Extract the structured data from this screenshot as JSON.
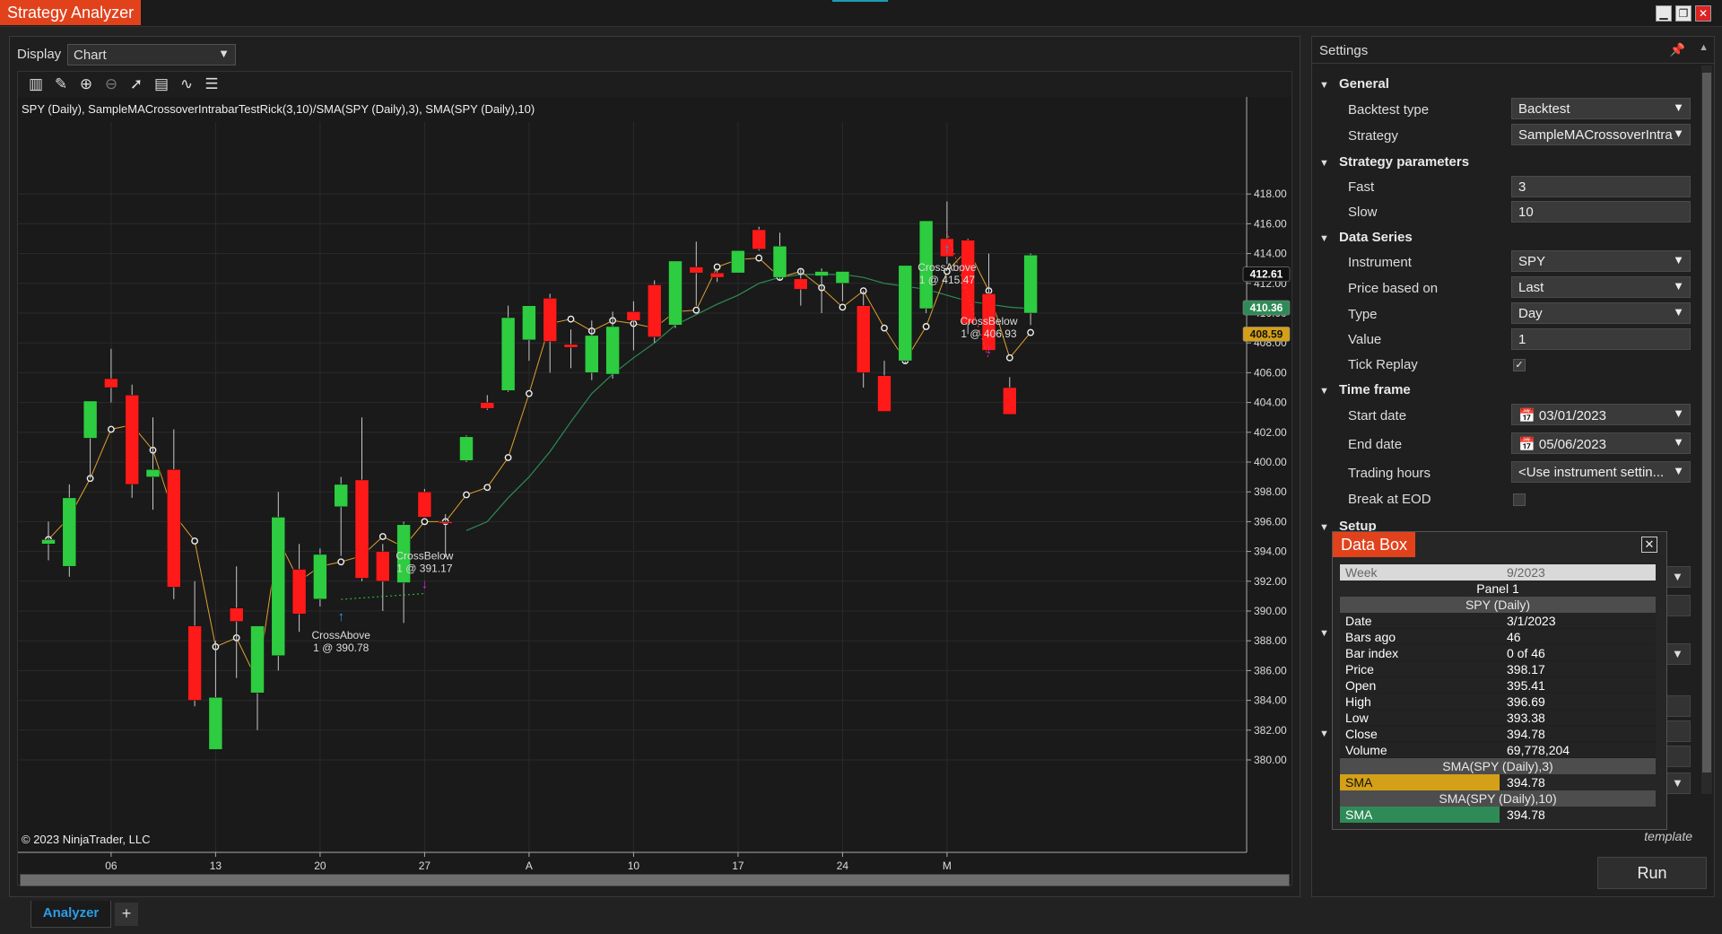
{
  "app": {
    "title": "Strategy Analyzer",
    "window_buttons": [
      "minimize",
      "restore",
      "close"
    ]
  },
  "display": {
    "label": "Display",
    "value": "Chart"
  },
  "toolbar": {
    "icons": [
      "bar-chart-icon",
      "pencil-icon",
      "zoom-in-icon",
      "zoom-out-icon",
      "pointer-icon",
      "properties-icon",
      "indicator-icon",
      "list-icon"
    ]
  },
  "chart": {
    "header": "SPY (Daily), SampleMACrossoverIntrabarTestRick(3,10)/SMA(SPY (Daily),3), SMA(SPY (Daily),10)",
    "copyright": "© 2023 NinjaTrader, LLC",
    "colors": {
      "up": "#2ecc40",
      "down": "#ff1a1a",
      "sma_fast": "#e0a030",
      "sma_slow": "#2e8b57",
      "bg": "#1a1a1a"
    }
  },
  "chart_data": {
    "type": "candlestick",
    "title": "SPY (Daily), SampleMACrossoverIntrabarTestRick(3,10)/SMA(SPY (Daily),3), SMA(SPY (Daily),10)",
    "y_ticks": [
      "380.00",
      "382.00",
      "384.00",
      "386.00",
      "388.00",
      "390.00",
      "392.00",
      "394.00",
      "396.00",
      "398.00",
      "400.00",
      "402.00",
      "404.00",
      "406.00",
      "408.00",
      "410.00",
      "412.00",
      "414.00",
      "416.00",
      "418.00"
    ],
    "ylim": [
      379,
      419.8
    ],
    "x_ticks": [
      "06",
      "13",
      "20",
      "27",
      "A",
      "10",
      "17",
      "24",
      "M"
    ],
    "x_tick_index": [
      3,
      8,
      13,
      18,
      23,
      28,
      33,
      38,
      43
    ],
    "ohlc": [
      [
        394.5,
        396.0,
        393.4,
        394.8
      ],
      [
        393.0,
        398.5,
        392.3,
        397.6
      ],
      [
        401.6,
        404.0,
        398.9,
        404.1
      ],
      [
        405.6,
        407.6,
        404.0,
        405.0
      ],
      [
        404.5,
        405.2,
        397.6,
        398.5
      ],
      [
        399.0,
        403.0,
        396.8,
        399.5
      ],
      [
        399.5,
        402.2,
        390.8,
        391.6
      ],
      [
        389.0,
        392.0,
        383.6,
        384.0
      ],
      [
        380.7,
        388.0,
        380.7,
        384.2
      ],
      [
        390.2,
        393.0,
        385.5,
        389.3
      ],
      [
        384.5,
        389.0,
        382.0,
        389.0
      ],
      [
        387.0,
        398.0,
        386.0,
        396.3
      ],
      [
        392.8,
        394.5,
        388.6,
        389.8
      ],
      [
        390.8,
        394.2,
        390.3,
        393.8
      ],
      [
        397.0,
        399.0,
        393.7,
        398.5
      ],
      [
        398.8,
        403.0,
        392.0,
        392.2
      ],
      [
        394.0,
        394.5,
        390.0,
        392.0
      ],
      [
        391.9,
        396.0,
        389.2,
        395.8
      ],
      [
        398.0,
        398.2,
        396.3,
        396.3
      ],
      [
        396.0,
        396.5,
        393.6,
        395.9
      ],
      [
        400.1,
        401.8,
        400.0,
        401.7
      ],
      [
        404.0,
        404.5,
        403.5,
        403.6
      ],
      [
        404.8,
        410.5,
        404.7,
        409.7
      ],
      [
        408.2,
        410.5,
        406.8,
        410.5
      ],
      [
        411.0,
        411.3,
        406.0,
        408.1
      ],
      [
        407.9,
        408.9,
        406.3,
        407.7
      ],
      [
        406.0,
        409.5,
        405.5,
        408.5
      ],
      [
        405.9,
        410.1,
        405.6,
        409.1
      ],
      [
        410.1,
        410.8,
        407.5,
        409.5
      ],
      [
        411.9,
        412.2,
        408.0,
        408.4
      ],
      [
        409.2,
        413.5,
        409.0,
        413.5
      ],
      [
        413.1,
        414.8,
        410.5,
        412.7
      ],
      [
        412.7,
        413.0,
        412.1,
        412.4
      ],
      [
        412.7,
        414.2,
        412.7,
        414.2
      ],
      [
        415.6,
        415.8,
        414.2,
        414.3
      ],
      [
        412.4,
        415.4,
        412.2,
        414.5
      ],
      [
        412.3,
        413.0,
        410.5,
        411.6
      ],
      [
        412.5,
        413.0,
        410.0,
        412.8
      ],
      [
        412.0,
        412.8,
        410.8,
        412.8
      ],
      [
        410.5,
        411.5,
        405.0,
        406.0
      ],
      [
        405.8,
        406.8,
        403.5,
        403.4
      ],
      [
        406.8,
        413.0,
        406.6,
        413.2
      ],
      [
        410.3,
        416.2,
        410.0,
        416.2
      ],
      [
        415.0,
        417.5,
        413.3,
        413.8
      ],
      [
        414.9,
        415.0,
        408.6,
        409.3
      ],
      [
        411.3,
        414.0,
        407.8,
        407.5
      ],
      [
        405.0,
        405.7,
        403.8,
        403.2
      ],
      [
        410.0,
        414.0,
        409.2,
        413.9
      ]
    ],
    "sma_fast_values": [
      394.8,
      396.3,
      398.9,
      402.2,
      402.5,
      400.8,
      396.5,
      394.7,
      387.6,
      388.2,
      385.3,
      394.8,
      392.0,
      393.0,
      393.3,
      393.7,
      395.0,
      394.3,
      396.0,
      396.0,
      397.8,
      398.3,
      400.3,
      404.6,
      409.3,
      409.6,
      408.8,
      409.5,
      409.3,
      409.0,
      410.1,
      410.2,
      413.1,
      413.6,
      413.7,
      412.4,
      412.8,
      411.7,
      410.4,
      411.5,
      409.0,
      406.8,
      409.1,
      412.8,
      414.3,
      411.5,
      407.0,
      408.7
    ],
    "sma_slow_start": 20,
    "sma_slow_values": [
      395.4,
      396.0,
      397.6,
      399.0,
      400.7,
      402.7,
      404.6,
      405.9,
      407.0,
      408.0,
      409.2,
      409.9,
      410.6,
      411.2,
      412.0,
      412.4,
      412.6,
      412.6,
      412.6,
      412.4,
      412.0,
      411.8,
      411.6,
      411.2,
      410.8,
      410.6,
      410.4,
      410.3
    ],
    "price_markers": [
      {
        "label": "412.61",
        "value": 412.61,
        "bg": "#111111",
        "fg": "#ffffff"
      },
      {
        "label": "410.36",
        "value": 410.36,
        "bg": "#2e8b57",
        "fg": "#ffffff"
      },
      {
        "label": "408.59",
        "value": 408.59,
        "bg": "#d4a017",
        "fg": "#111111"
      }
    ],
    "trade_annotations": [
      {
        "index": 14,
        "text1": "CrossAbove",
        "text2": "1 @ 390.78",
        "color": "#2b9de6",
        "direction": "up",
        "price": 390.78
      },
      {
        "index": 18,
        "text1": "CrossBelow",
        "text2": "1 @ 391.17",
        "color": "#e020e0",
        "direction": "down",
        "price": 391.17
      },
      {
        "index": 43,
        "text1": "CrossAbove",
        "text2": "1 @ 415.47",
        "color": "#2b9de6",
        "direction": "up",
        "price": 415.47
      },
      {
        "index": 45,
        "text1": "CrossBelow",
        "text2": "1 @ 406.93",
        "color": "#e020e0",
        "direction": "down",
        "price": 406.93
      }
    ]
  },
  "settings": {
    "title": "Settings",
    "general": {
      "label": "General",
      "backtest_type_label": "Backtest type",
      "backtest_type_value": "Backtest",
      "strategy_label": "Strategy",
      "strategy_value": "SampleMACrossoverIntra"
    },
    "strategy_parameters": {
      "label": "Strategy parameters",
      "fast_label": "Fast",
      "fast_value": "3",
      "slow_label": "Slow",
      "slow_value": "10"
    },
    "data_series": {
      "label": "Data Series",
      "instrument_label": "Instrument",
      "instrument_value": "SPY",
      "price_based_on_label": "Price based on",
      "price_based_on_value": "Last",
      "type_label": "Type",
      "type_value": "Day",
      "value_label": "Value",
      "value_value": "1",
      "tick_replay_label": "Tick Replay",
      "tick_replay_checked": true
    },
    "time_frame": {
      "label": "Time frame",
      "start_date_label": "Start date",
      "start_date_value": "03/01/2023",
      "end_date_label": "End date",
      "end_date_value": "05/06/2023",
      "trading_hours_label": "Trading hours",
      "trading_hours_value": "<Use instrument settin...",
      "break_at_eod_label": "Break at EOD",
      "break_at_eod_checked": false
    },
    "setup": {
      "label": "Setup"
    },
    "template_label": "template",
    "run_label": "Run"
  },
  "databox": {
    "title": "Data Box",
    "week_label": "Week",
    "week_value": "9/2023",
    "panel_label": "Panel 1",
    "series_label": "SPY (Daily)",
    "rows": [
      {
        "k": "Date",
        "v": "3/1/2023"
      },
      {
        "k": "Bars ago",
        "v": "46"
      },
      {
        "k": "Bar index",
        "v": "0 of 46"
      },
      {
        "k": "Price",
        "v": "398.17"
      },
      {
        "k": "Open",
        "v": "395.41"
      },
      {
        "k": "High",
        "v": "396.69"
      },
      {
        "k": "Low",
        "v": "393.38"
      },
      {
        "k": "Close",
        "v": "394.78"
      },
      {
        "k": "Volume",
        "v": "69,778,204"
      }
    ],
    "sma3_header": "SMA(SPY (Daily),3)",
    "sma3_label": "SMA",
    "sma3_value": "394.78",
    "sma10_header": "SMA(SPY (Daily),10)",
    "sma10_label": "SMA",
    "sma10_value": "394.78"
  },
  "tabs": {
    "active": "Analyzer",
    "add": "+"
  }
}
